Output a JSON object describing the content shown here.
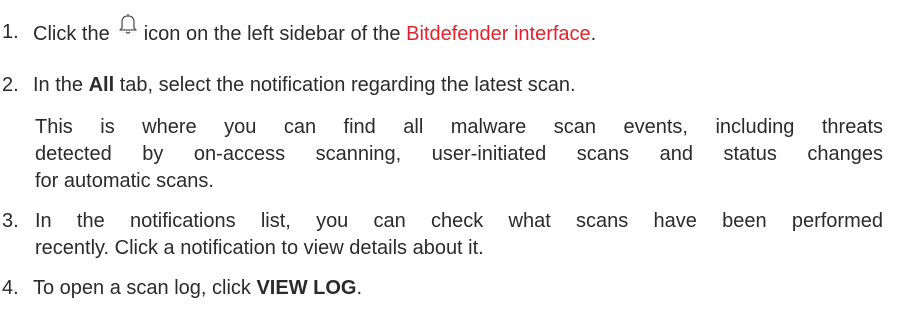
{
  "steps": [
    {
      "number": "1.",
      "text_before_icon": "Click the",
      "icon": "bell-icon",
      "text_after_icon": "icon on the left sidebar of the",
      "link_text": "Bitdefender interface",
      "text_end": "."
    },
    {
      "number": "2.",
      "text_before_bold": "In the",
      "bold": "All",
      "text_after_bold": "tab, select the notification regarding the latest scan.",
      "note_lines": [
        "This is where you can find all malware scan events, including threats",
        "detected by on-access scanning, user-initiated scans and status changes",
        "for automatic scans."
      ]
    },
    {
      "number": "3.",
      "lines": [
        "In the notifications list, you can check what scans have been performed",
        "recently. Click a notification to view details about it."
      ]
    },
    {
      "number": "4.",
      "text_before_bold": "To open a scan log, click",
      "bold": "VIEW LOG",
      "text_end": "."
    }
  ],
  "colors": {
    "text": "#2b2b2b",
    "link": "#e2232b"
  }
}
